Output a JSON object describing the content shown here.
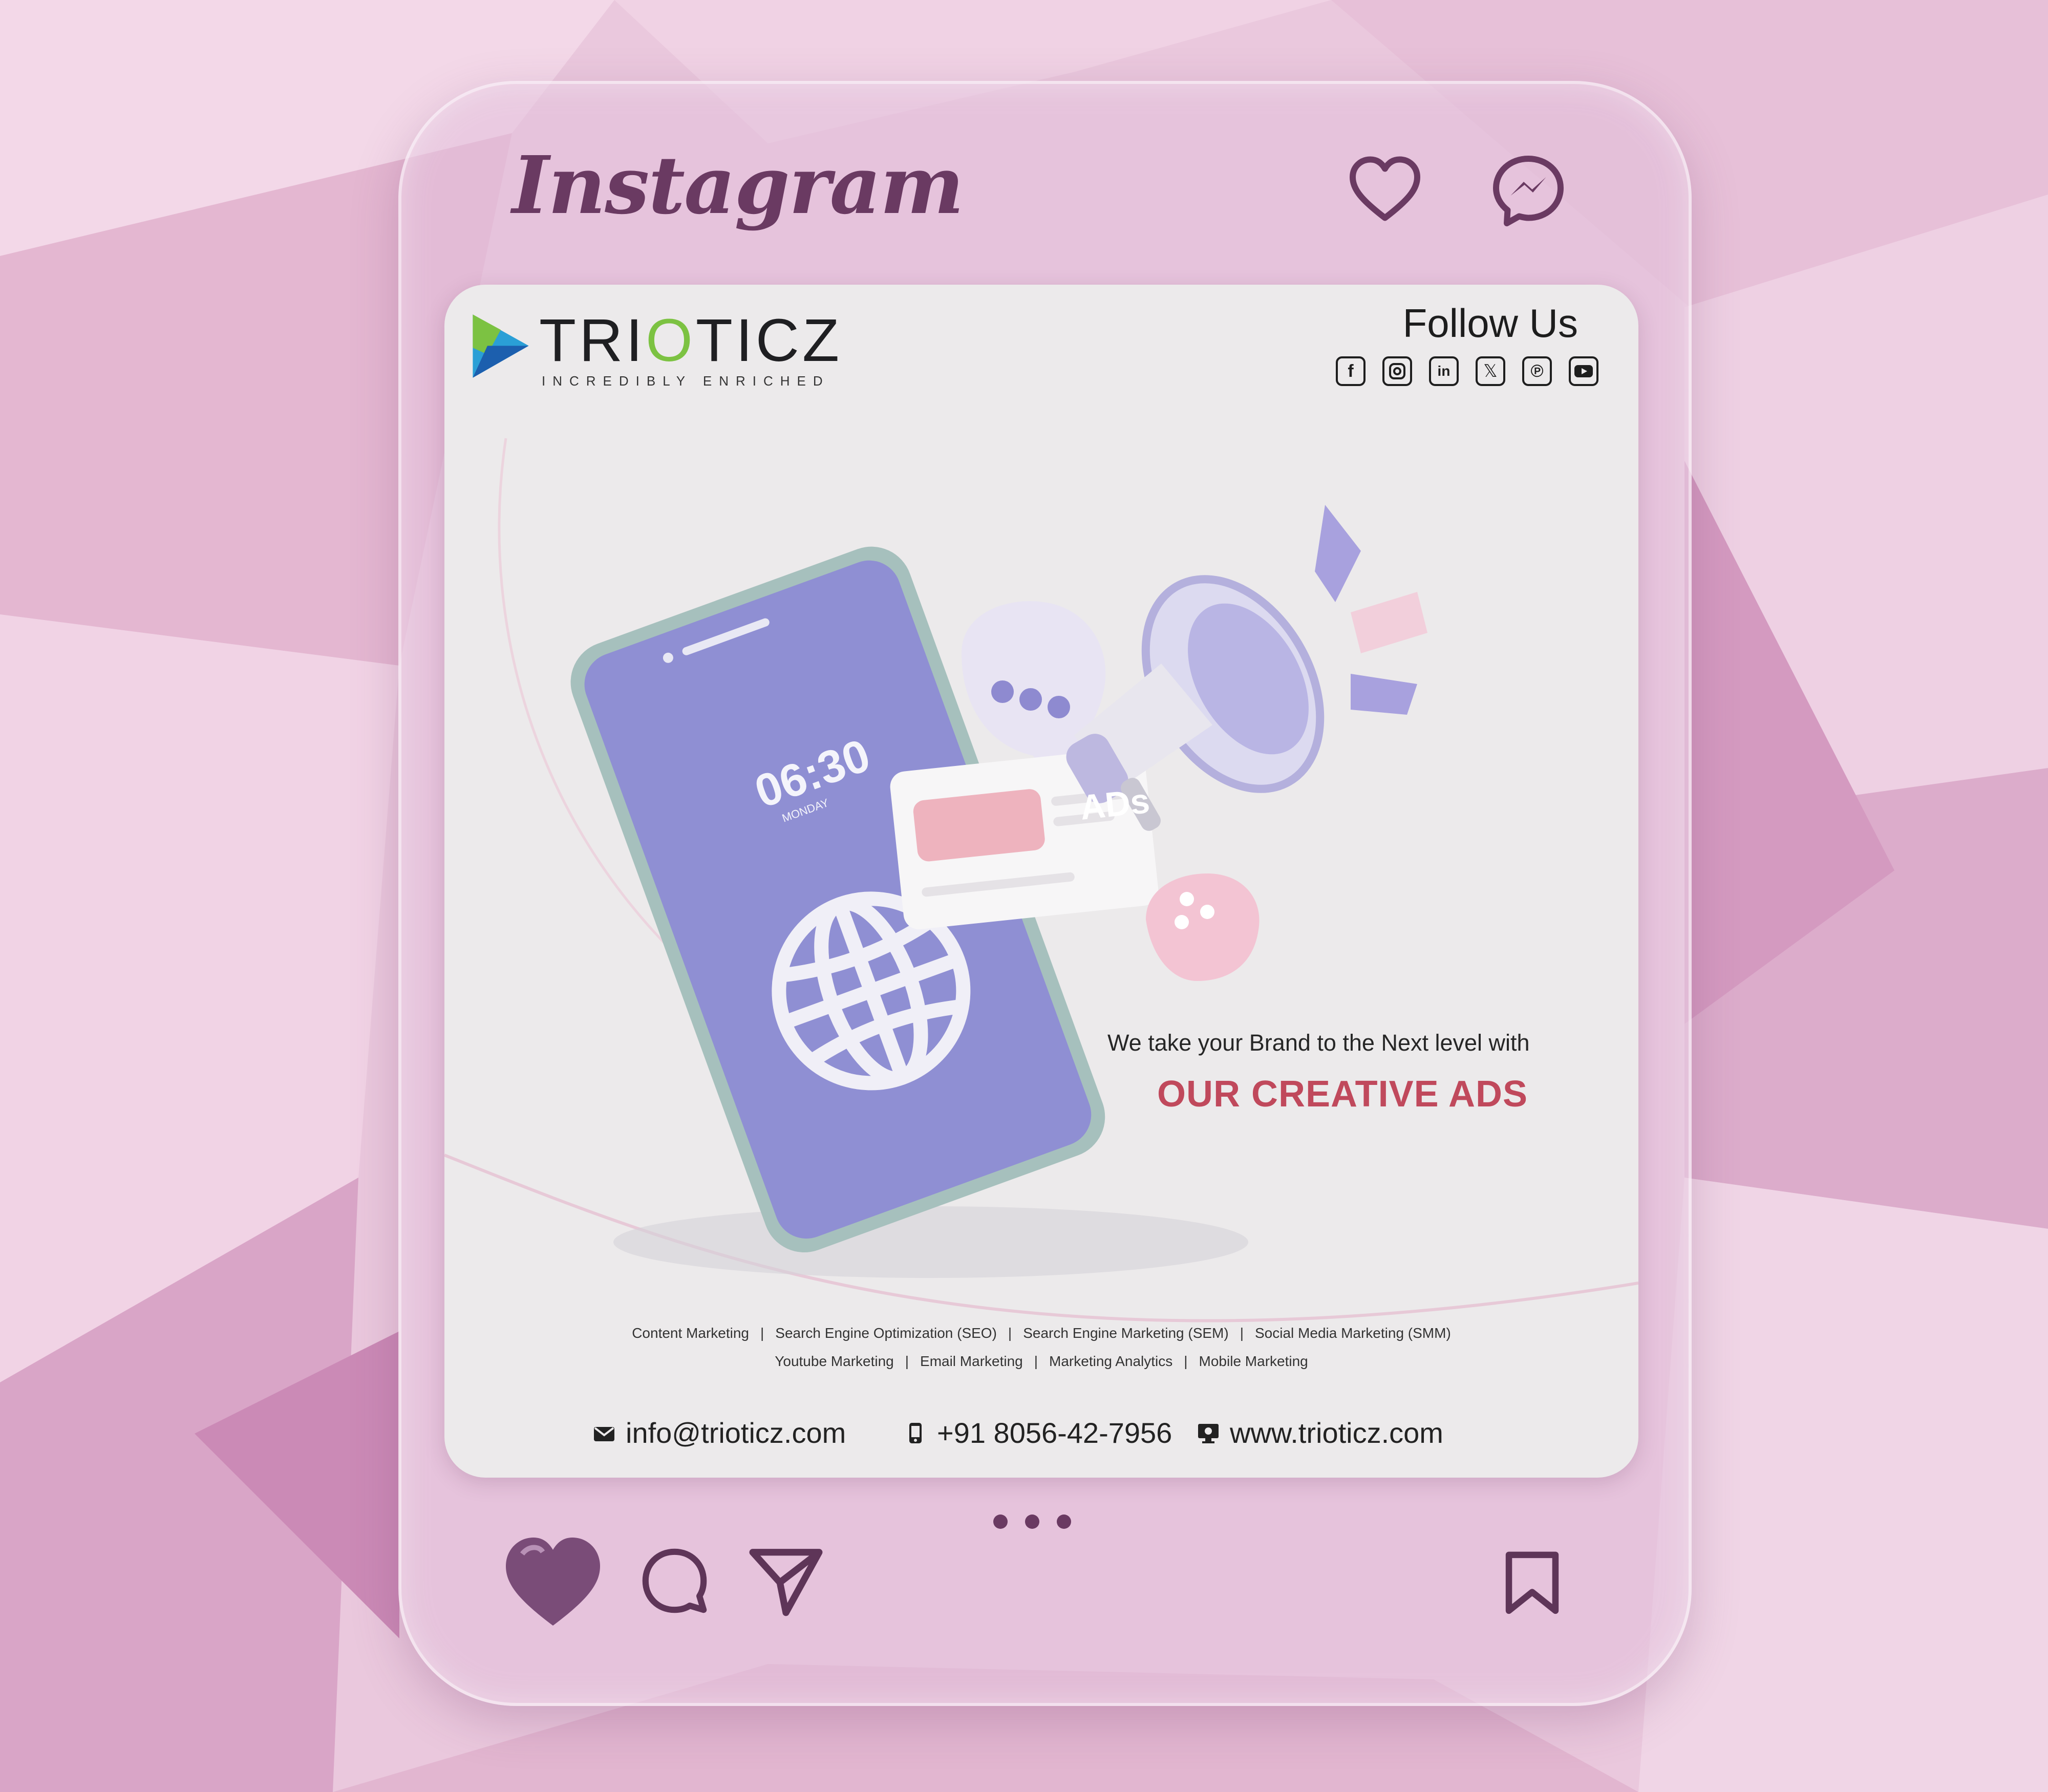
{
  "header": {
    "app_title": "Instagram",
    "like_icon": "heart-outline-icon",
    "messenger_icon": "messenger-icon"
  },
  "post": {
    "brand": {
      "part1": "TRI",
      "part2": "O",
      "part3": "TICZ",
      "tagline": "INCREDIBLY ENRICHED"
    },
    "follow": {
      "title": "Follow Us",
      "icons": [
        "facebook-icon",
        "instagram-icon",
        "linkedin-icon",
        "x-icon",
        "pinterest-icon",
        "youtube-icon"
      ]
    },
    "phone_screen": {
      "time": "06:30",
      "day": "MONDAY"
    },
    "ads_badge": "ADs",
    "headline": "We take your Brand to the Next level with",
    "cta": "OUR CREATIVE ADS",
    "services_line1": [
      "Content Marketing",
      "Search Engine Optimization (SEO)",
      "Search Engine Marketing (SEM)",
      "Social Media Marketing (SMM)"
    ],
    "services_line2": [
      "Youtube Marketing",
      "Email Marketing",
      "Marketing Analytics",
      "Mobile Marketing"
    ],
    "separator": "|",
    "contact": {
      "email": "info@trioticz.com",
      "phone": "+91 8056-42-7956",
      "website": "www.trioticz.com"
    }
  },
  "footer": {
    "icons": [
      "heart-filled-icon",
      "comment-icon",
      "share-icon",
      "bookmark-icon"
    ]
  },
  "colors": {
    "accent": "#6a3a62",
    "cta": "#c0495c",
    "brand_green": "#7cc242",
    "phone": "#8f8fd3"
  }
}
